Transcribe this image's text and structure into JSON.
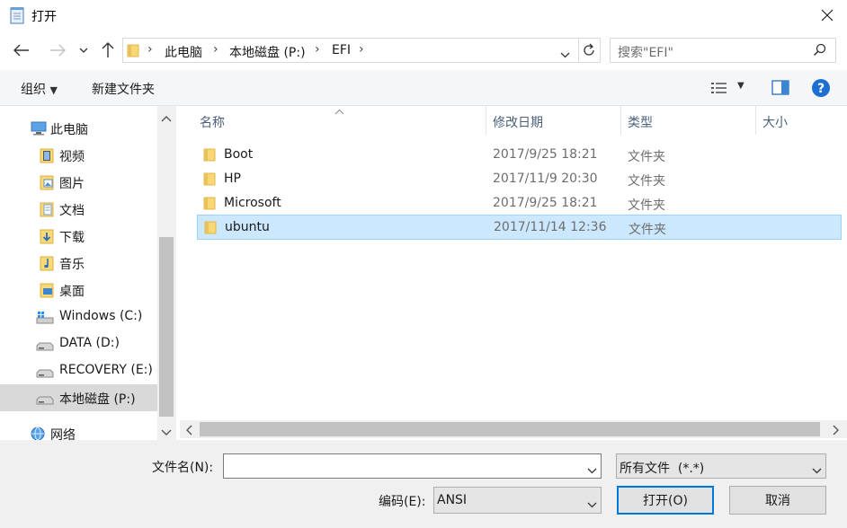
{
  "window": {
    "title": "打开"
  },
  "address": {
    "crumbs": [
      "此电脑",
      "本地磁盘 (P:)",
      "EFI"
    ]
  },
  "search": {
    "placeholder": "搜索\"EFI\""
  },
  "toolbar": {
    "organize": "组织",
    "new_folder": "新建文件夹"
  },
  "sidebar": {
    "items": [
      {
        "label": "此电脑",
        "icon": "computer-icon"
      },
      {
        "label": "视频",
        "icon": "videos-folder-icon"
      },
      {
        "label": "图片",
        "icon": "pictures-folder-icon"
      },
      {
        "label": "文档",
        "icon": "documents-folder-icon"
      },
      {
        "label": "下载",
        "icon": "downloads-folder-icon"
      },
      {
        "label": "音乐",
        "icon": "music-folder-icon"
      },
      {
        "label": "桌面",
        "icon": "desktop-folder-icon"
      },
      {
        "label": "Windows (C:)",
        "icon": "windows-drive-icon"
      },
      {
        "label": "DATA (D:)",
        "icon": "drive-icon"
      },
      {
        "label": "RECOVERY (E:)",
        "icon": "drive-icon"
      },
      {
        "label": "本地磁盘 (P:)",
        "icon": "drive-icon",
        "selected": true
      },
      {
        "label": "网络",
        "icon": "network-icon"
      }
    ]
  },
  "columns": {
    "name": "名称",
    "modified": "修改日期",
    "type": "类型",
    "size": "大小"
  },
  "files": [
    {
      "name": "Boot",
      "modified": "2017/9/25 18:21",
      "type": "文件夹"
    },
    {
      "name": "HP",
      "modified": "2017/11/9 20:30",
      "type": "文件夹"
    },
    {
      "name": "Microsoft",
      "modified": "2017/9/25 18:21",
      "type": "文件夹"
    },
    {
      "name": "ubuntu",
      "modified": "2017/11/14 12:36",
      "type": "文件夹",
      "selected": true
    }
  ],
  "bottom": {
    "filename_label": "文件名(N):",
    "filename_value": "",
    "filter_value": "所有文件  (*.*)",
    "encoding_label": "编码(E):",
    "encoding_value": "ANSI",
    "open_button": "打开(O)",
    "cancel_button": "取消"
  },
  "colors": {
    "accent": "#0078d7",
    "selection_bg": "#cce8ff",
    "selection_border": "#99d1ff",
    "folder": "#f8d775"
  }
}
